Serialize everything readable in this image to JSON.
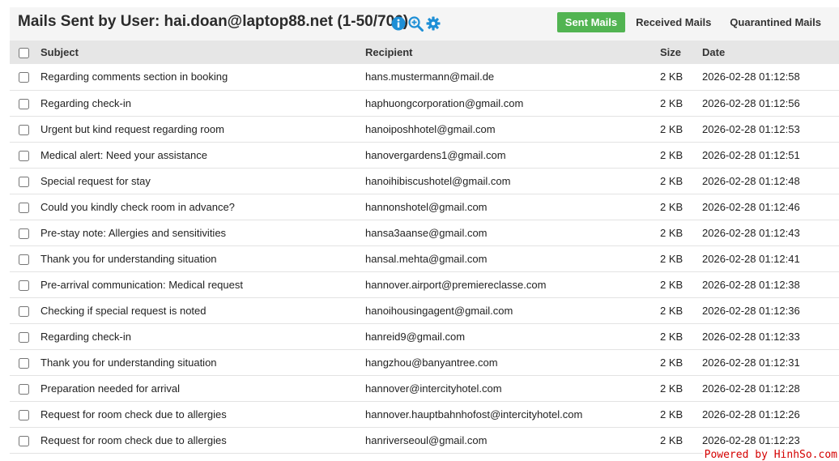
{
  "header": {
    "title": "Mails Sent by User: hai.doan@laptop88.net (1-50/706)",
    "tabs": [
      {
        "label": "Sent Mails",
        "active": true
      },
      {
        "label": "Received Mails",
        "active": false
      },
      {
        "label": "Quarantined Mails",
        "active": false
      }
    ],
    "icons": [
      "info-icon",
      "zoom-in-icon",
      "gear-icon"
    ],
    "accent_color": "#52b452",
    "icon_color": "#1e8fd6"
  },
  "table": {
    "columns": {
      "subject": "Subject",
      "recipient": "Recipient",
      "size": "Size",
      "date": "Date"
    },
    "rows": [
      {
        "subject": "Regarding comments section in booking",
        "recipient": "hans.mustermann@mail.de",
        "size": "2 KB",
        "date": "2026-02-28 01:12:58"
      },
      {
        "subject": "Regarding check-in",
        "recipient": "haphuongcorporation@gmail.com",
        "size": "2 KB",
        "date": "2026-02-28 01:12:56"
      },
      {
        "subject": "Urgent but kind request regarding room",
        "recipient": "hanoiposhhotel@gmail.com",
        "size": "2 KB",
        "date": "2026-02-28 01:12:53"
      },
      {
        "subject": "Medical alert: Need your assistance",
        "recipient": "hanovergardens1@gmail.com",
        "size": "2 KB",
        "date": "2026-02-28 01:12:51"
      },
      {
        "subject": "Special request for stay",
        "recipient": "hanoihibiscushotel@gmail.com",
        "size": "2 KB",
        "date": "2026-02-28 01:12:48"
      },
      {
        "subject": "Could you kindly check room in advance?",
        "recipient": "hannonshotel@gmail.com",
        "size": "2 KB",
        "date": "2026-02-28 01:12:46"
      },
      {
        "subject": "Pre-stay note: Allergies and sensitivities",
        "recipient": "hansa3aanse@gmail.com",
        "size": "2 KB",
        "date": "2026-02-28 01:12:43"
      },
      {
        "subject": "Thank you for understanding situation",
        "recipient": "hansal.mehta@gmail.com",
        "size": "2 KB",
        "date": "2026-02-28 01:12:41"
      },
      {
        "subject": "Pre-arrival communication: Medical request",
        "recipient": "hannover.airport@premiereclasse.com",
        "size": "2 KB",
        "date": "2026-02-28 01:12:38"
      },
      {
        "subject": "Checking if special request is noted",
        "recipient": "hanoihousingagent@gmail.com",
        "size": "2 KB",
        "date": "2026-02-28 01:12:36"
      },
      {
        "subject": "Regarding check-in",
        "recipient": "hanreid9@gmail.com",
        "size": "2 KB",
        "date": "2026-02-28 01:12:33"
      },
      {
        "subject": "Thank you for understanding situation",
        "recipient": "hangzhou@banyantree.com",
        "size": "2 KB",
        "date": "2026-02-28 01:12:31"
      },
      {
        "subject": "Preparation needed for arrival",
        "recipient": "hannover@intercityhotel.com",
        "size": "2 KB",
        "date": "2026-02-28 01:12:28"
      },
      {
        "subject": "Request for room check due to allergies",
        "recipient": "hannover.hauptbahnhofost@intercityhotel.com",
        "size": "2 KB",
        "date": "2026-02-28 01:12:26"
      },
      {
        "subject": "Request for room check due to allergies",
        "recipient": "hanriverseoul@gmail.com",
        "size": "2 KB",
        "date": "2026-02-28 01:12:23"
      }
    ]
  },
  "footer": {
    "text": "Powered by HinhSo.com"
  }
}
